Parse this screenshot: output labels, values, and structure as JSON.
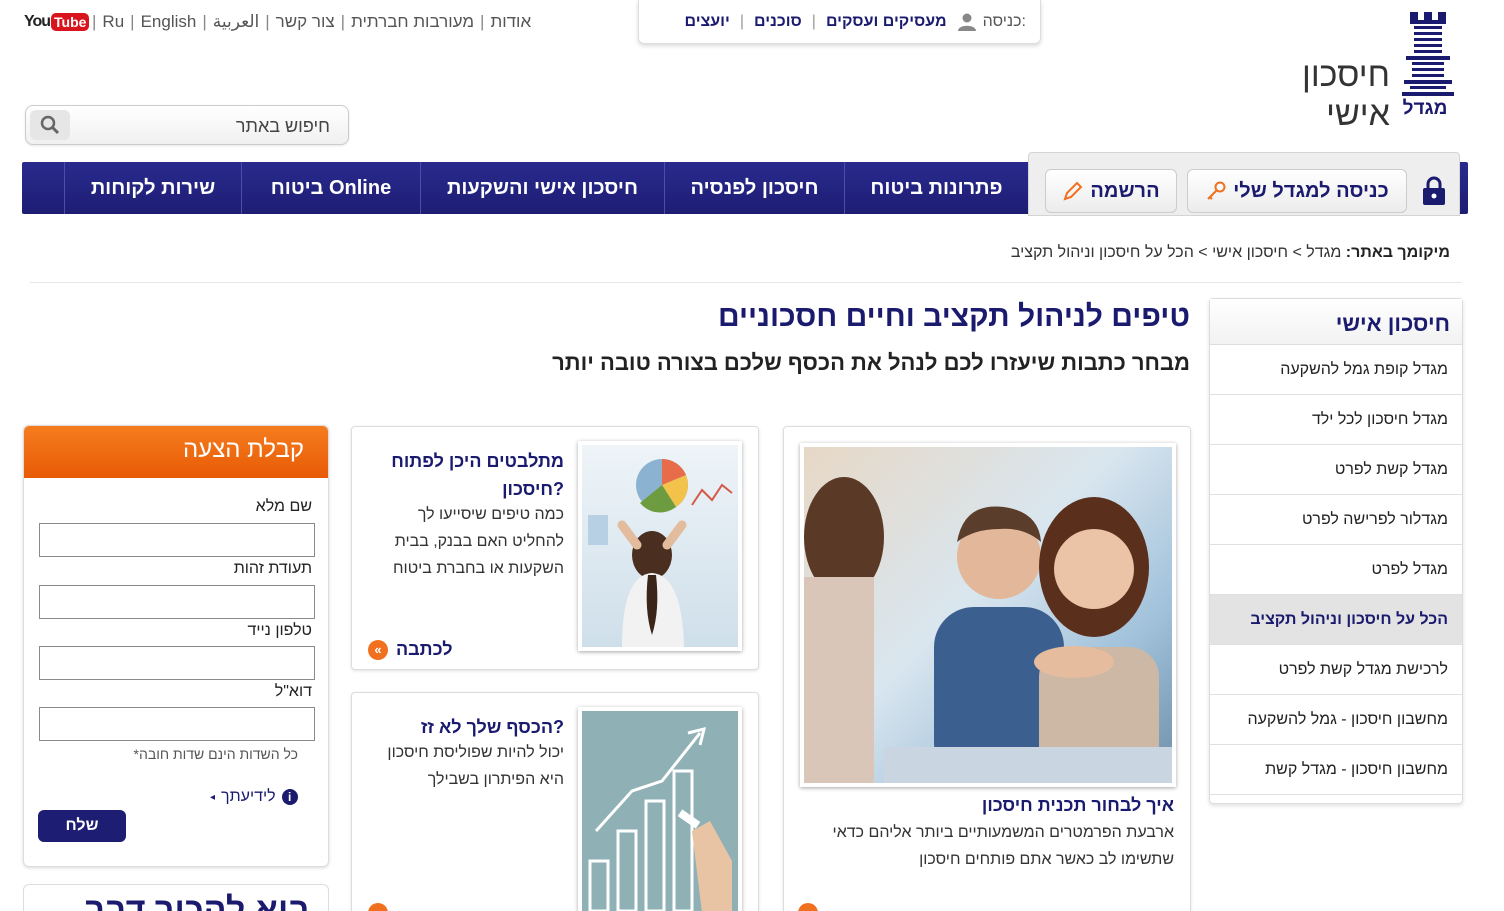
{
  "utility": {
    "youtube_you": "You",
    "youtube_tube": "Tube",
    "links": [
      "Ru",
      "English",
      "العربية",
      "צור קשר",
      "מעורבות חברתית",
      "אודות"
    ]
  },
  "login_panel": {
    "label": "כניסה:",
    "links": [
      "מעסיקים ועסקים",
      "סוכנים",
      "יועצים"
    ]
  },
  "brand": {
    "section_title": "חיסכון אישי",
    "logo_text": "מגדל"
  },
  "search": {
    "placeholder": "חיפוש באתר"
  },
  "auth": {
    "login_label": "כניסה למגדל שלי",
    "register_label": "הרשמה"
  },
  "nav": [
    "פתרונות ביטוח",
    "חיסכון לפנסיה",
    "חיסכון אישי והשקעות",
    "ביטוח Online",
    "שירות לקוחות"
  ],
  "breadcrumb": {
    "label": "מיקומך באתר:",
    "items": [
      "מגדל",
      "חיסכון אישי",
      "הכל על חיסכון וניהול תקציב"
    ],
    "sep": ">"
  },
  "sidebar": {
    "title": "חיסכון אישי",
    "items": [
      "מגדל קופת גמל להשקעה",
      "מגדל חיסכון לכל ילד",
      "מגדל קשת לפרט",
      "מגדלור לפרישה לפרט",
      "מגדל לפרט",
      "הכל על חיסכון וניהול תקציב",
      "לרכישת מגדל קשת לפרט",
      "מחשבון חיסכון - גמל להשקעה",
      "מחשבון חיסכון - מגדל קשת"
    ],
    "active_index": 5
  },
  "main": {
    "title": "טיפים לניהול תקציב וחיים חסכוניים",
    "subtitle": "מבחר כתבות שיעזרו לכם לנהל את הכסף שלכם בצורה טובה יותר"
  },
  "cards": {
    "big": {
      "title": "איך לבחור תכנית חיסכון",
      "desc_line1": "ארבעת הפרמטרים המשמעותיים ביותר אליהם כדאי",
      "desc_line2": "שתשימו לב כאשר אתם פותחים חיסכון"
    },
    "small1": {
      "title_line1": "מתלבטים היכן לפתוח",
      "title_line2": "חיסכון?",
      "desc_line1": "כמה טיפים שיסייעו לך",
      "desc_line2": "להחליט האם בבנק, בבית",
      "desc_line3": "השקעות או בחברת ביטוח",
      "more": "לכתבה"
    },
    "small2": {
      "title": "הכסף שלך לא זז?",
      "desc_line1": "יכול להיות שפוליסת חיסכון",
      "desc_line2": "היא הפיתרון בשבילך"
    }
  },
  "form": {
    "title": "קבלת הצעה",
    "fields": [
      "שם מלא",
      "תעודת זהות",
      "טלפון נייד",
      "דוא\"ל"
    ],
    "note": "*כל השדות הינם שדות חובה",
    "learn_more": "לידיעתך",
    "submit": "שלח"
  },
  "promo": {
    "text": "בוא להכיר דבר"
  },
  "colors": {
    "brand": "#1d1d74",
    "accent": "#f07020"
  }
}
